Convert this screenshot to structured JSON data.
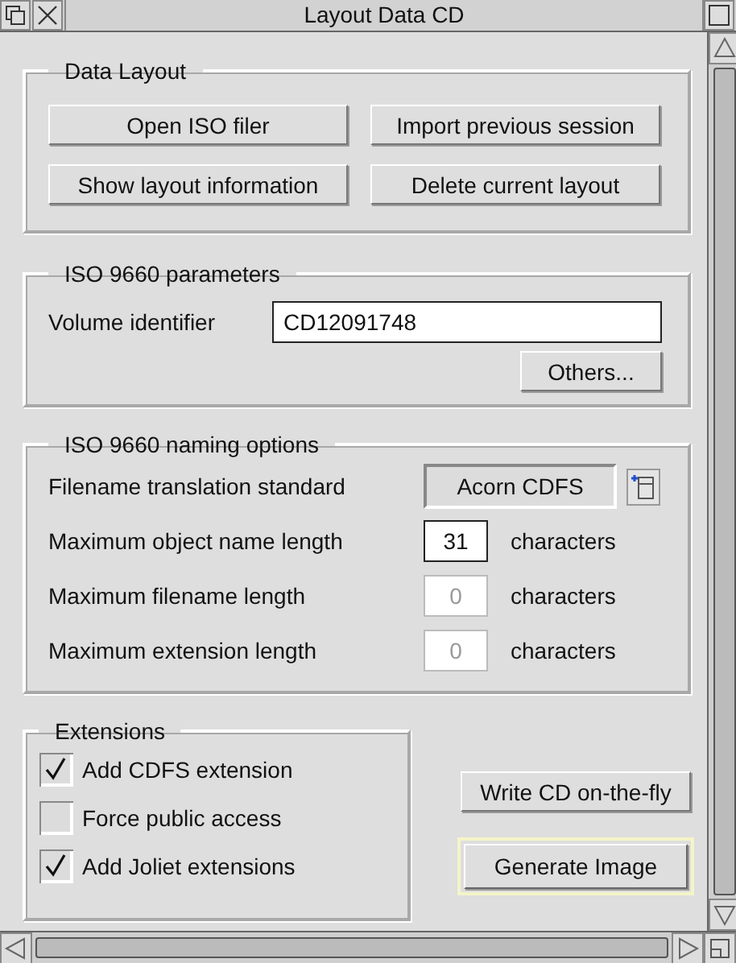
{
  "window": {
    "title": "Layout Data CD"
  },
  "data_layout": {
    "title": "Data Layout",
    "buttons": [
      "Open ISO filer",
      "Import previous session",
      "Show layout information",
      "Delete current layout"
    ]
  },
  "iso_parameters": {
    "title": "ISO 9660 parameters",
    "volume_label": "Volume identifier",
    "volume_value": "CD12091748",
    "others_button": "Others..."
  },
  "naming": {
    "title": "ISO 9660 naming options",
    "translation_label": "Filename translation standard",
    "translation_value": "Acorn CDFS",
    "limits": [
      {
        "label": "Maximum object name length",
        "value": "31",
        "disabled": false,
        "unit": "characters"
      },
      {
        "label": "Maximum filename length",
        "value": "0",
        "disabled": true,
        "unit": "characters"
      },
      {
        "label": "Maximum extension length",
        "value": "0",
        "disabled": true,
        "unit": "characters"
      }
    ]
  },
  "extensions": {
    "title": "Extensions",
    "options": [
      {
        "label": "Add CDFS extension",
        "checked": true
      },
      {
        "label": "Force public access",
        "checked": false
      },
      {
        "label": "Add Joliet extensions",
        "checked": true
      }
    ]
  },
  "actions": [
    {
      "label": "Write CD on-the-fly",
      "default": false
    },
    {
      "label": "Generate Image",
      "default": true
    }
  ]
}
